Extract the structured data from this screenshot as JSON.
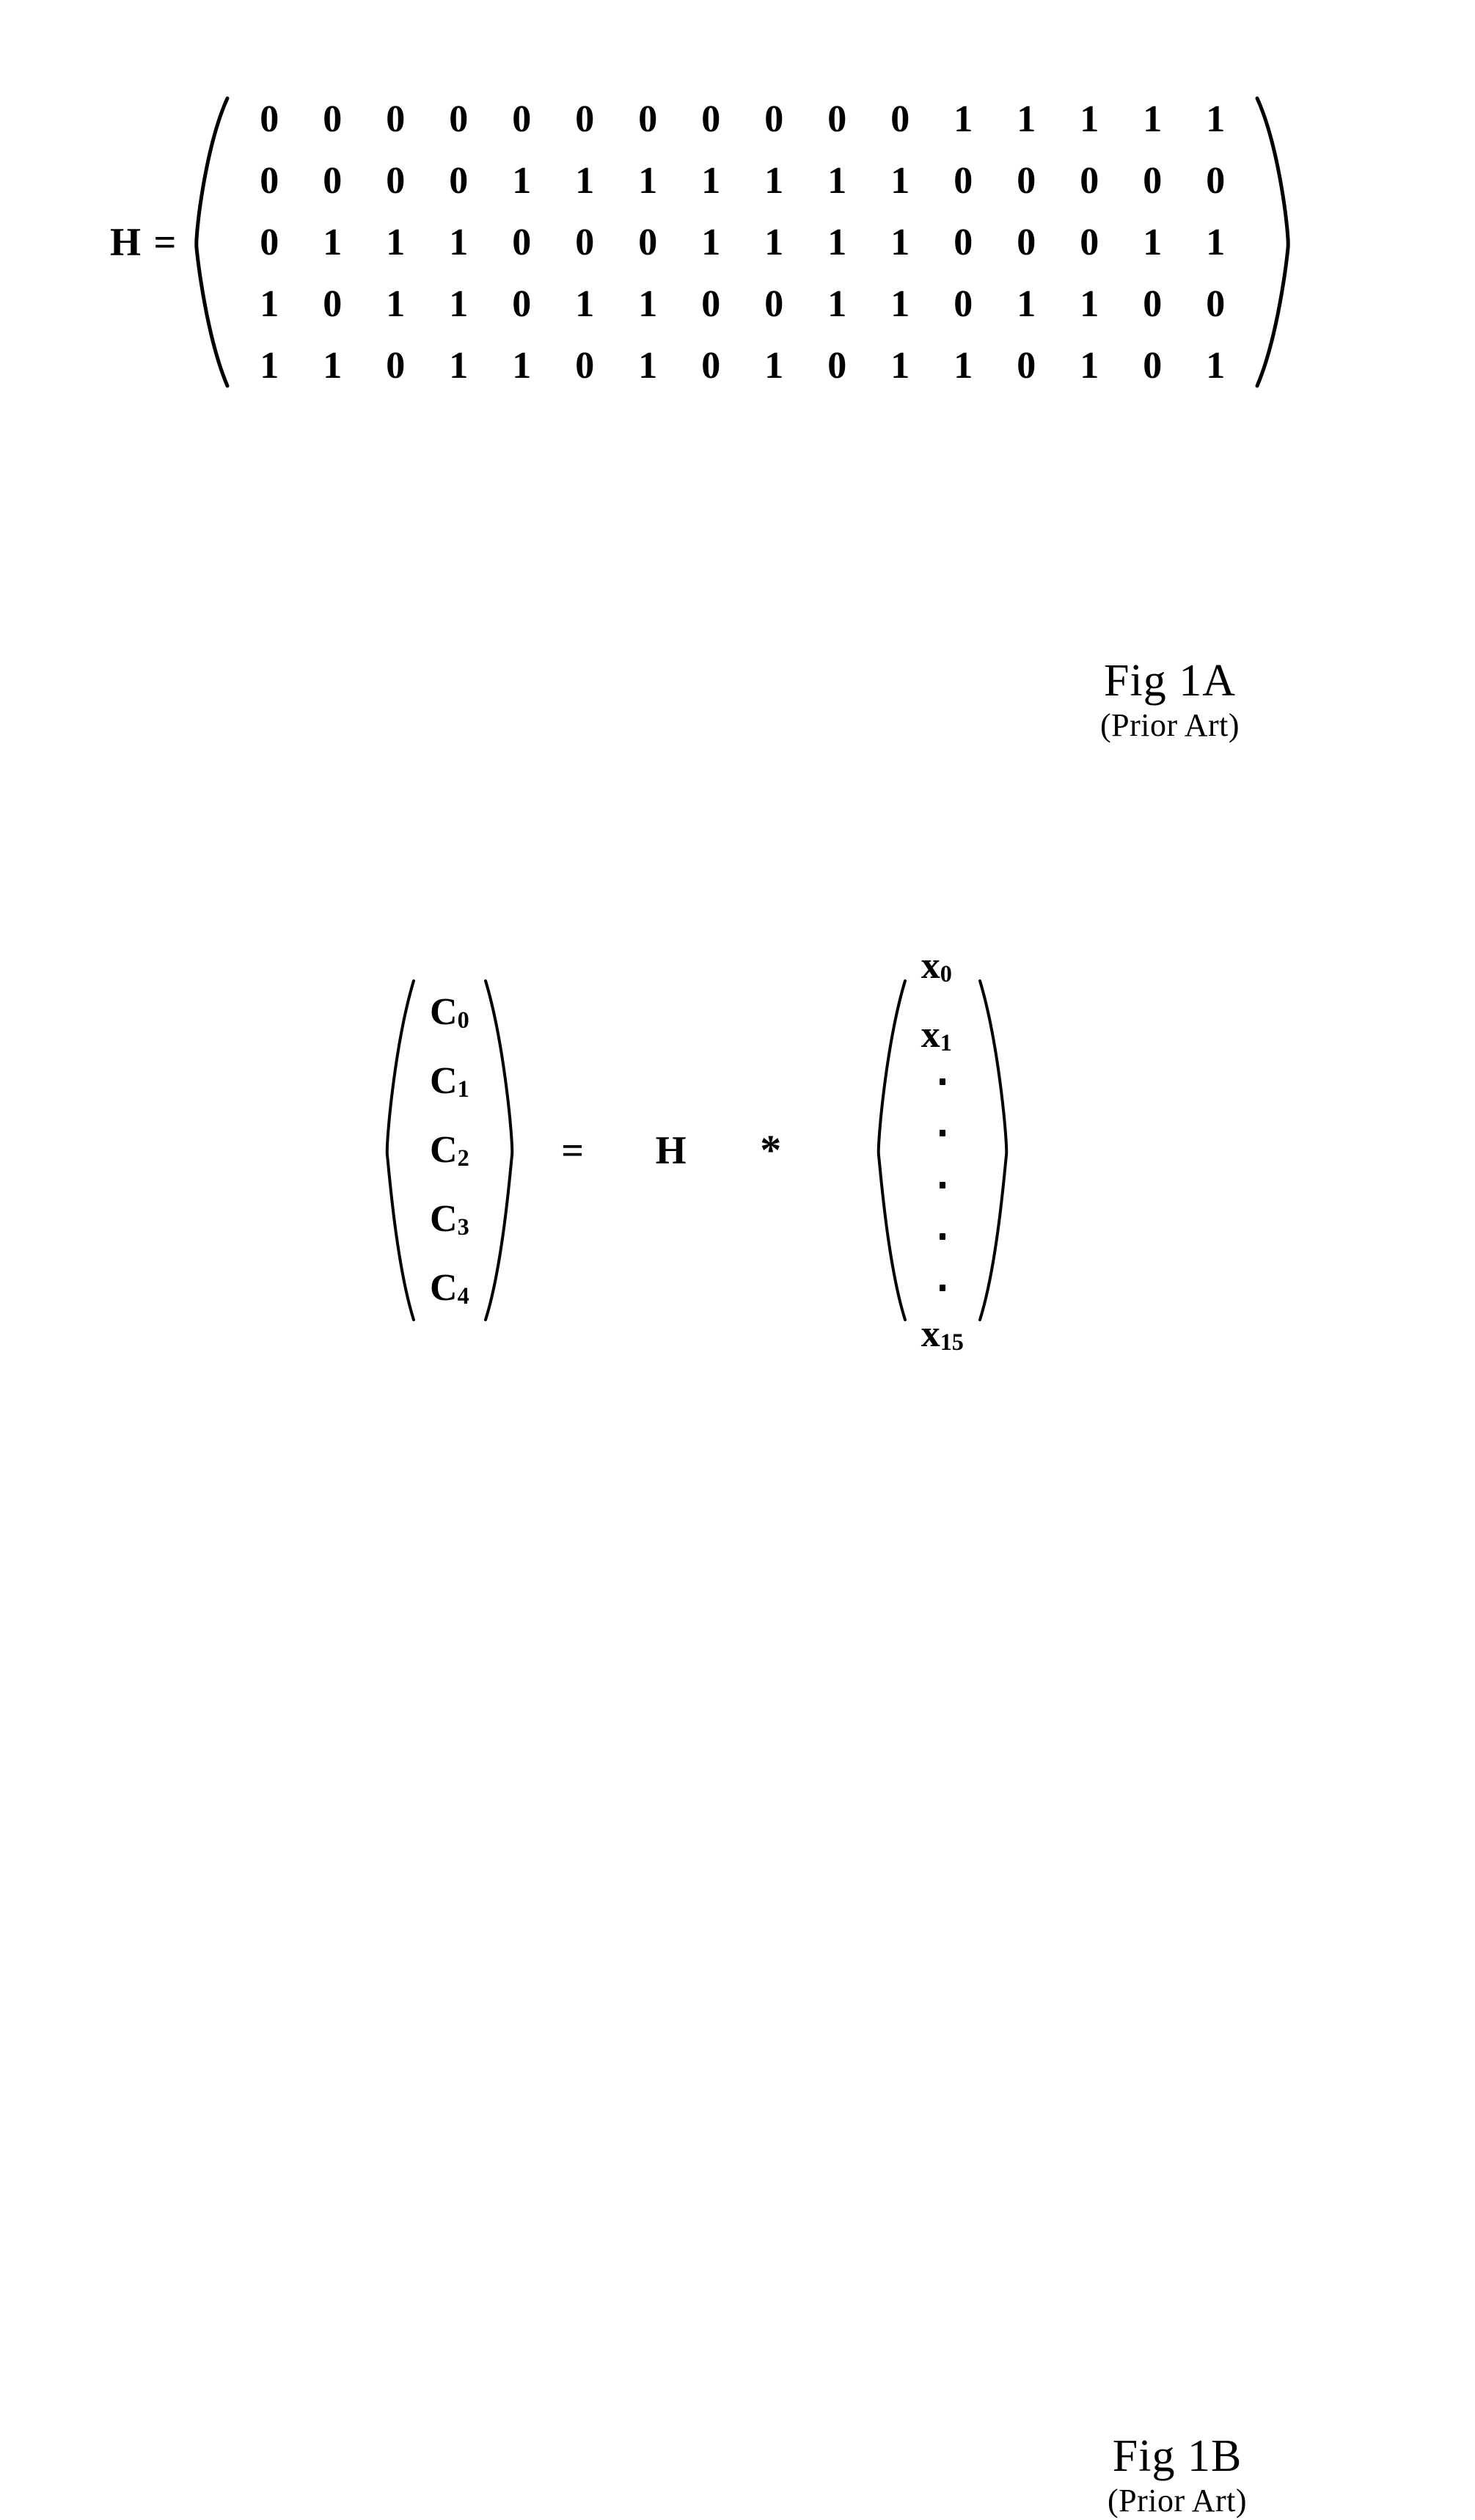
{
  "figures": [
    {
      "id": "fig-1a",
      "caption_title": "Fig 1A",
      "caption_sub": "(Prior Art)",
      "equation_label": "H =",
      "matrix": {
        "rows": 5,
        "cols": 16,
        "values": [
          [
            0,
            0,
            0,
            0,
            0,
            0,
            0,
            0,
            0,
            0,
            0,
            1,
            1,
            1,
            1,
            1
          ],
          [
            0,
            0,
            0,
            0,
            1,
            1,
            1,
            1,
            1,
            1,
            1,
            0,
            0,
            0,
            0,
            0
          ],
          [
            0,
            1,
            1,
            1,
            0,
            0,
            0,
            1,
            1,
            1,
            1,
            0,
            0,
            0,
            1,
            1
          ],
          [
            1,
            0,
            1,
            1,
            0,
            1,
            1,
            0,
            0,
            1,
            1,
            0,
            1,
            1,
            0,
            0
          ],
          [
            1,
            1,
            0,
            1,
            1,
            0,
            1,
            0,
            1,
            0,
            1,
            1,
            0,
            1,
            0,
            1
          ]
        ]
      }
    },
    {
      "id": "fig-1b",
      "caption_title": "Fig 1B",
      "caption_sub": "(Prior Art)",
      "left_vector": {
        "base": "C",
        "items": [
          {
            "base": "C",
            "sub": "0"
          },
          {
            "base": "C",
            "sub": "1"
          },
          {
            "base": "C",
            "sub": "2"
          },
          {
            "base": "C",
            "sub": "3"
          },
          {
            "base": "C",
            "sub": "4"
          }
        ]
      },
      "operators": {
        "equals": "=",
        "matrix_symbol": "H",
        "multiply": "*"
      },
      "right_vector": {
        "base": "x",
        "items_top": [
          {
            "base": "x",
            "sub": "0"
          },
          {
            "base": "x",
            "sub": "1"
          }
        ],
        "ellipsis_dots": 5,
        "items_bottom": [
          {
            "base": "x",
            "sub": "15"
          }
        ]
      }
    }
  ],
  "colors": {
    "ink": "#000000",
    "page": "#ffffff"
  }
}
